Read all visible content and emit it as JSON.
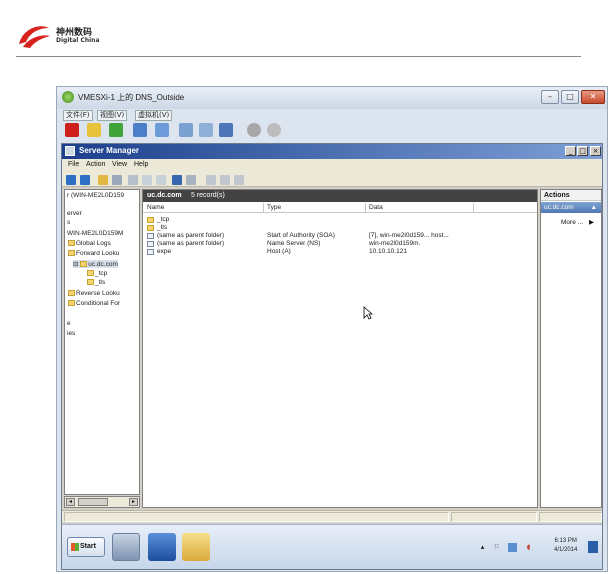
{
  "document": {
    "logo_name": "神州数码",
    "logo_sub": "Digital China"
  },
  "vm_window": {
    "title": "VMESXi-1 上的 DNS_Outside",
    "menu": [
      "文件(F)",
      "视图(V)",
      "虚拟机(V)"
    ],
    "controls": {
      "minimize": "–",
      "maximize": "□",
      "close": "✕"
    }
  },
  "server_manager": {
    "title": "Server Manager",
    "menu": [
      "File",
      "Action",
      "View",
      "Help"
    ],
    "controls": {
      "minimize": "_",
      "maximize": "□",
      "close": "×"
    }
  },
  "tree": {
    "items": [
      {
        "label": "r (WIN-ME2L0D159",
        "indent": 0
      },
      {
        "label": "erver",
        "indent": 0
      },
      {
        "label": "s",
        "indent": 0
      },
      {
        "label": "WIN-ME2L0D159M",
        "indent": 0
      },
      {
        "label": "Global Logs",
        "indent": 1
      },
      {
        "label": "Forward Looku",
        "indent": 1
      },
      {
        "label": "uc.dc.com",
        "indent": 2
      },
      {
        "label": "_tcp",
        "indent": 3
      },
      {
        "label": "_tls",
        "indent": 3
      },
      {
        "label": "Reverse Looku",
        "indent": 1
      },
      {
        "label": "Conditional For",
        "indent": 1
      },
      {
        "label": "e",
        "indent": 0
      },
      {
        "label": "ies",
        "indent": 0
      }
    ]
  },
  "zone": {
    "name": "uc.dc.com",
    "count": "5 record(s)",
    "columns": [
      "Name",
      "Type",
      "Data"
    ],
    "records": [
      {
        "name": "_tcp",
        "type": "",
        "data": "",
        "icon": "folder"
      },
      {
        "name": "_tls",
        "type": "",
        "data": "",
        "icon": "folder"
      },
      {
        "name": "(same as parent folder)",
        "type": "Start of Authority (SOA)",
        "data": "[7], win-me2l0d159... host...",
        "icon": "doc"
      },
      {
        "name": "(same as parent folder)",
        "type": "Name Server (NS)",
        "data": "win-me2l0d159m.",
        "icon": "doc"
      },
      {
        "name": "expe",
        "type": "Host (A)",
        "data": "10.10.10.121",
        "icon": "doc"
      }
    ]
  },
  "actions": {
    "heading": "Actions",
    "zone_label": "uc.dc.com",
    "collapse": "▲",
    "more": "More ...",
    "more_arrow": "▶"
  },
  "taskbar": {
    "start_label": "Start",
    "clock_time": "6:13 PM",
    "clock_date": "4/1/2014"
  },
  "colors": {
    "title_bar": "#1b3f8c",
    "zone_header": "#434343",
    "actions_selected": "#5177b2"
  }
}
